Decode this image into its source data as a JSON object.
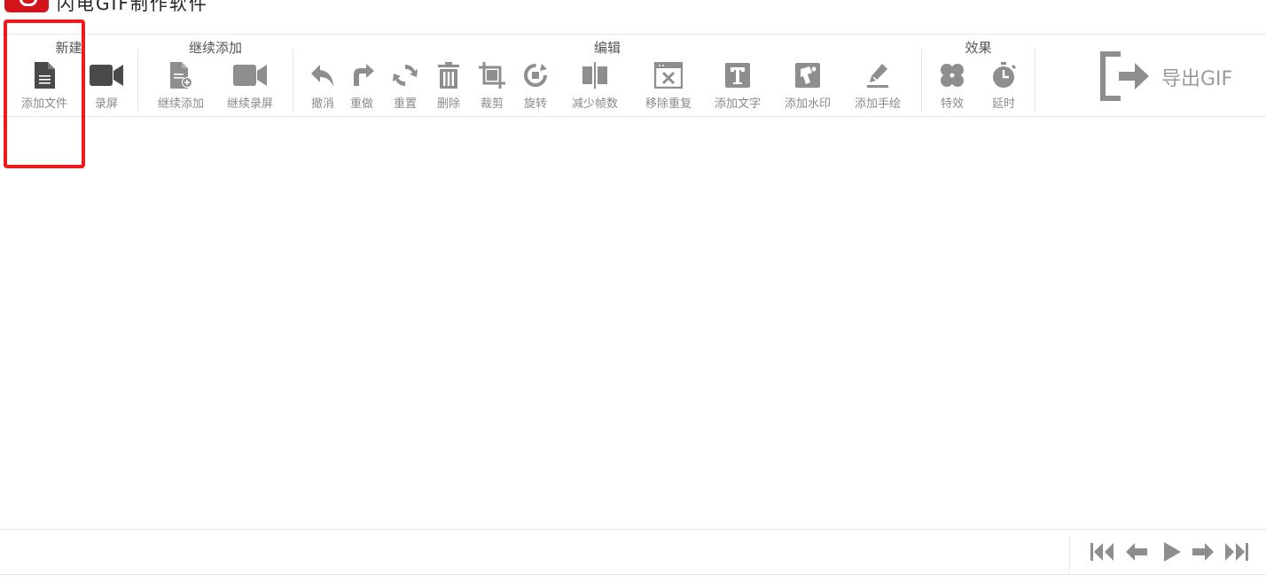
{
  "app": {
    "title": "闪电GIF制作软件"
  },
  "toolbar": {
    "groups": {
      "new": {
        "title": "新建",
        "items": {
          "add_file": "添加文件",
          "record": "录屏"
        }
      },
      "continue": {
        "title": "继续添加",
        "items": {
          "continue_add": "继续添加",
          "continue_record": "继续录屏"
        }
      },
      "edit": {
        "title": "编辑",
        "items": {
          "undo": "撤消",
          "redo": "重做",
          "reset": "重置",
          "delete": "删除",
          "crop": "裁剪",
          "rotate": "旋转",
          "reduce_frames": "减少帧数",
          "remove_duplicates": "移除重复",
          "add_text": "添加文字",
          "add_watermark": "添加水印",
          "add_drawing": "添加手绘"
        }
      },
      "effects": {
        "title": "效果",
        "items": {
          "effects": "特效",
          "delay": "延时"
        }
      }
    },
    "export": {
      "label": "导出GIF"
    }
  },
  "colors": {
    "icon": "#8e8e8e",
    "icon_dark": "#4a4a4a",
    "highlight": "#ef1b1b",
    "brand": "#d4141b"
  }
}
